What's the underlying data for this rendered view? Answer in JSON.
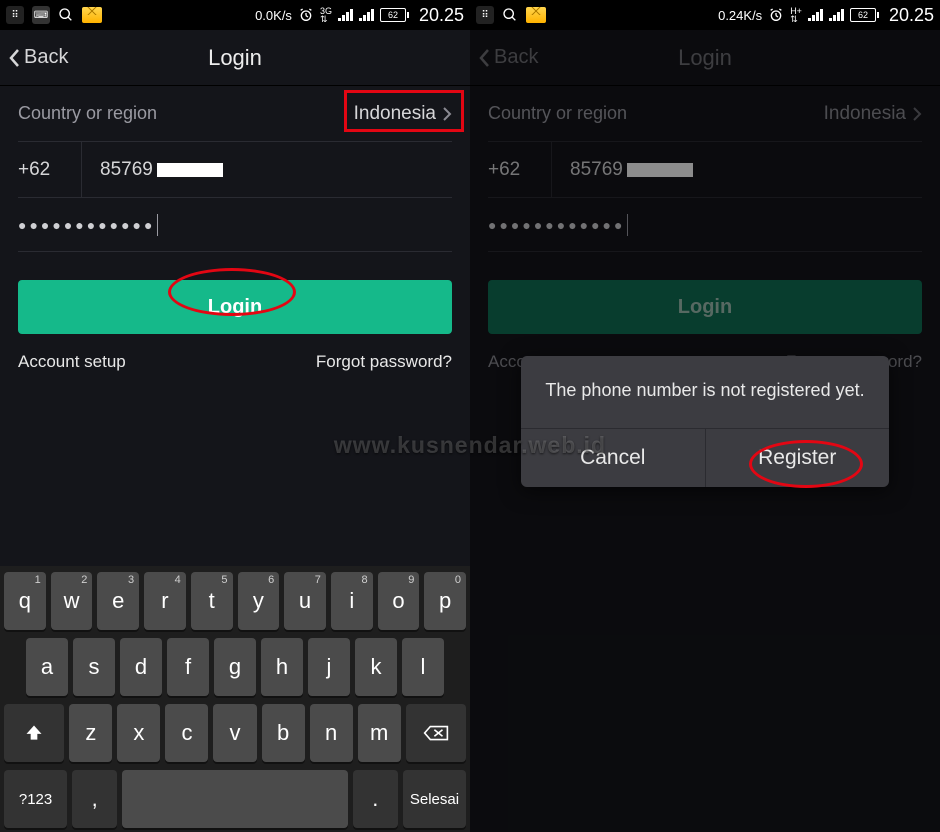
{
  "watermark": "www.kusnendar.web.id",
  "status": {
    "speed_left": "0.0K/s",
    "speed_right": "0.24K/s",
    "battery": "62",
    "time": "20.25",
    "net_label": "3G"
  },
  "nav": {
    "back": "Back",
    "title": "Login"
  },
  "form": {
    "country_label": "Country or region",
    "country_value": "Indonesia",
    "dial_code": "+62",
    "phone_prefix": "85769",
    "password_mask": "●●●●●●●●●●●●",
    "login_btn": "Login",
    "account_setup": "Account setup",
    "forgot": "Forgot password?"
  },
  "dialog": {
    "message": "The phone number is not registered yet.",
    "cancel": "Cancel",
    "register": "Register"
  },
  "kb": {
    "r1": [
      "q",
      "w",
      "e",
      "r",
      "t",
      "y",
      "u",
      "i",
      "o",
      "p"
    ],
    "r1n": [
      "1",
      "2",
      "3",
      "4",
      "5",
      "6",
      "7",
      "8",
      "9",
      "0"
    ],
    "r2": [
      "a",
      "s",
      "d",
      "f",
      "g",
      "h",
      "j",
      "k",
      "l"
    ],
    "r3": [
      "z",
      "x",
      "c",
      "v",
      "b",
      "n",
      "m"
    ],
    "sym": "?123",
    "comma": ",",
    "period": ".",
    "done": "Selesai"
  }
}
